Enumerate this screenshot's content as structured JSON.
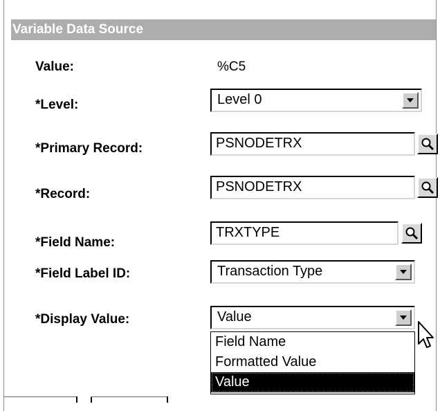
{
  "section": {
    "title": "Variable Data Source"
  },
  "fields": {
    "value": {
      "label": "Value:",
      "value": "%C5"
    },
    "level": {
      "label": "*Level:",
      "value": "Level 0"
    },
    "primary_record": {
      "label": "*Primary Record:",
      "value": "PSNODETRX"
    },
    "record": {
      "label": "*Record:",
      "value": "PSNODETRX"
    },
    "field_name": {
      "label": "*Field Name:",
      "value": "TRXTYPE"
    },
    "field_label_id": {
      "label": "*Field Label ID:",
      "value": "Transaction Type"
    },
    "display_value": {
      "label": "*Display Value:",
      "value": "Value",
      "options": [
        "Field Name",
        "Formatted Value",
        "Value"
      ],
      "highlighted": "Value"
    }
  },
  "icons": {
    "lookup": "magnifier-icon",
    "dropdown": "chevron-down-icon",
    "pointer": "mouse-pointer-icon"
  },
  "colors": {
    "header_bg": "#adadad",
    "header_text": "#ffffff",
    "selected_bg": "#000000",
    "selected_text": "#ffffff"
  }
}
